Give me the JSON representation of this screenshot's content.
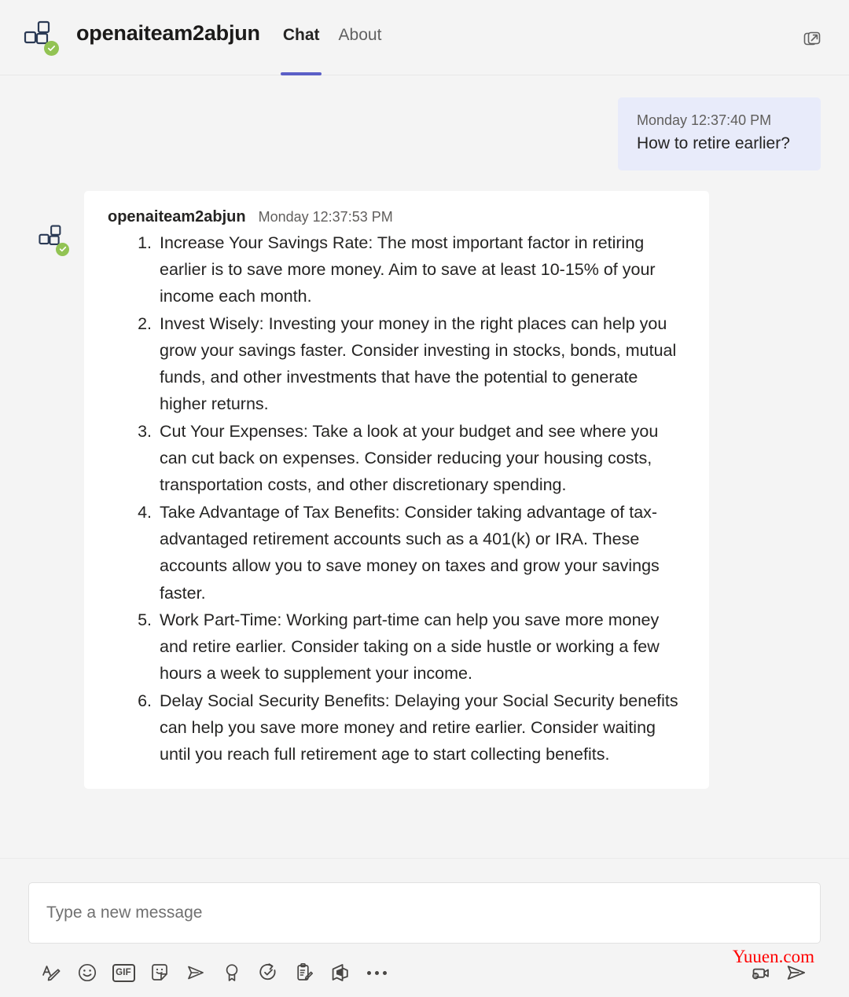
{
  "header": {
    "app_icon": "apps-grid-icon",
    "verified_icon": "verified-checkmark-icon",
    "title": "openaiteam2abjun",
    "tabs": [
      {
        "label": "Chat",
        "active": true
      },
      {
        "label": "About",
        "active": false
      }
    ],
    "popout_icon": "open-in-new-window-icon",
    "accent_color": "#5b5fc7",
    "verified_color": "#92c353"
  },
  "conversation": {
    "outgoing_message": {
      "timestamp": "Monday 12:37:40 PM",
      "text": "How to retire earlier?",
      "bubble_color": "#e8ebfa"
    },
    "incoming_message": {
      "sender": "openaiteam2abjun",
      "timestamp": "Monday 12:37:53 PM",
      "avatar_icon": "apps-grid-icon",
      "verified_icon": "verified-checkmark-icon",
      "card_color": "#ffffff",
      "list_items": [
        "Increase Your Savings Rate: The most important factor in retiring earlier is to save more money. Aim to save at least 10-15% of your income each month.",
        "Invest Wisely: Investing your money in the right places can help you grow your savings faster. Consider investing in stocks, bonds, mutual funds, and other investments that have the potential to generate higher returns.",
        "Cut Your Expenses: Take a look at your budget and see where you can cut back on expenses. Consider reducing your housing costs, transportation costs, and other discretionary spending.",
        "Take Advantage of Tax Benefits: Consider taking advantage of tax-advantaged retirement accounts such as a 401(k) or IRA. These accounts allow you to save money on taxes and grow your savings faster.",
        "Work Part-Time: Working part-time can help you save more money and retire earlier. Consider taking on a side hustle or working a few hours a week to supplement your income.",
        "Delay Social Security Benefits: Delaying your Social Security benefits can help you save more money and retire earlier. Consider waiting until you reach full retirement age to start collecting benefits."
      ]
    }
  },
  "composer": {
    "placeholder": "Type a new message",
    "value": "",
    "left_tools": [
      {
        "name": "format-text-icon",
        "label": "Format"
      },
      {
        "name": "emoji-icon",
        "label": "Emoji"
      },
      {
        "name": "gif-icon",
        "label": "GIF"
      },
      {
        "name": "sticker-icon",
        "label": "Sticker"
      },
      {
        "name": "send-plane-outline-icon",
        "label": "Stream"
      },
      {
        "name": "praise-ribbon-icon",
        "label": "Praise"
      },
      {
        "name": "approvals-clock-icon",
        "label": "Approvals"
      },
      {
        "name": "forms-clipboard-icon",
        "label": "Forms"
      },
      {
        "name": "azure-devops-icon",
        "label": "Azure DevOps"
      },
      {
        "name": "more-options-icon",
        "label": "More options"
      }
    ],
    "right_tools": [
      {
        "name": "video-message-icon",
        "label": "Video message"
      },
      {
        "name": "send-icon",
        "label": "Send"
      }
    ],
    "gif_label": "GIF"
  },
  "watermark": {
    "text": "Yuuen.com",
    "color": "#ff0000"
  }
}
